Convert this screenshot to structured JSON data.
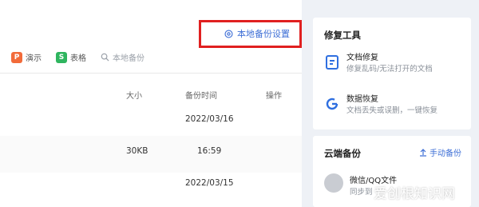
{
  "toolbar": {
    "settings_label": "本地备份设置",
    "filters": [
      {
        "label": "演示",
        "icon": "P",
        "color": "#f26b3a"
      },
      {
        "label": "表格",
        "icon": "S",
        "color": "#2fb55f"
      }
    ],
    "search_placeholder": "本地备份"
  },
  "table": {
    "headers": {
      "size": "大小",
      "time": "备份时间",
      "action": "操作"
    },
    "rows": [
      {
        "date": "2022/03/16"
      },
      {
        "size": "30KB",
        "time": "16:59"
      },
      {
        "date": "2022/03/15"
      }
    ]
  },
  "repair_tools": {
    "title": "修复工具",
    "items": [
      {
        "name": "文档修复",
        "desc": "修复乱码/无法打开的文档",
        "icon": "doc-repair-icon",
        "color": "#2f6fe0"
      },
      {
        "name": "数据恢复",
        "desc": "文档丢失或误删，一键恢复",
        "icon": "data-recover-icon",
        "color": "#2f6fe0"
      }
    ]
  },
  "cloud_backup": {
    "title": "云端备份",
    "manual_label": "手动备份",
    "item_name": "微信/QQ文件",
    "item_desc": "同步到"
  },
  "watermark": "爱创根知识网"
}
